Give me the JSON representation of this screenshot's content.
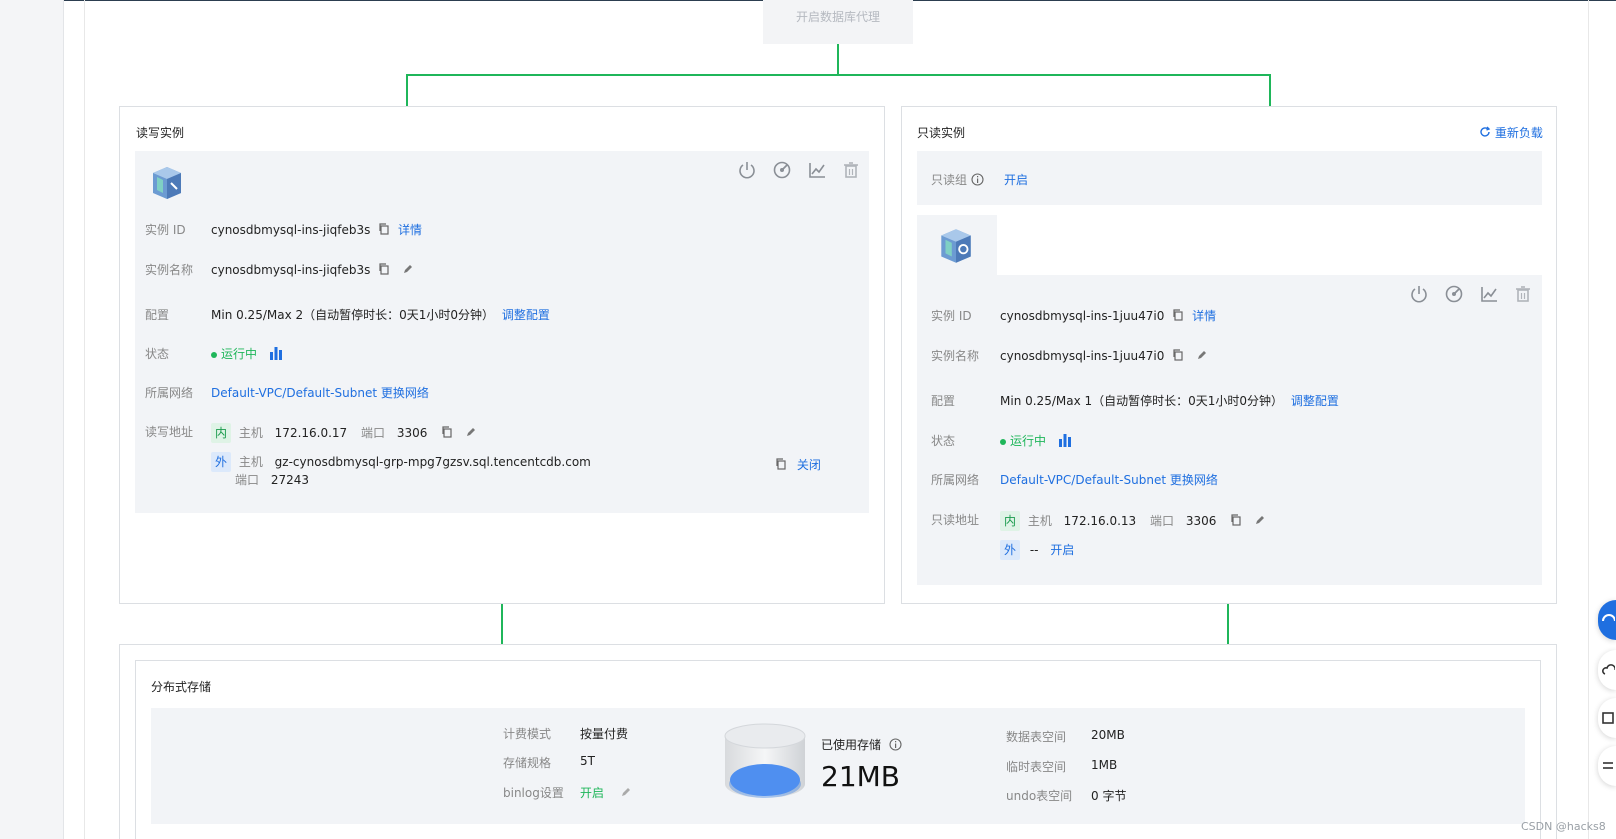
{
  "proxy": {
    "label": "开启数据库代理"
  },
  "rw": {
    "title": "读写实例",
    "id_label": "实例 ID",
    "id_value": "cynosdbmysql-ins-jiqfeb3s",
    "detail_link": "详情",
    "name_label": "实例名称",
    "name_value": "cynosdbmysql-ins-jiqfeb3s",
    "config_label": "配置",
    "config_value": "Min 0.25/Max 2（自动暂停时长：0天1小时0分钟）",
    "config_link": "调整配置",
    "status_label": "状态",
    "status_value": "运行中",
    "network_label": "所属网络",
    "vpc": "Default-VPC",
    "subnet": "/Default-Subnet",
    "change_net": "更换网络",
    "addr_label": "读写地址",
    "inner_tag": "内",
    "host_label": "主机",
    "inner_host": "172.16.0.17",
    "port_label": "端口",
    "inner_port": "3306",
    "outer_tag": "外",
    "outer_host": "gz-cynosdbmysql-grp-mpg7gzsv.sql.tencentcdb.com",
    "outer_port": "27243",
    "close_link": "关闭"
  },
  "ro": {
    "title": "只读实例",
    "reload_link": "重新负载",
    "group_label": "只读组",
    "group_link": "开启",
    "id_label": "实例 ID",
    "id_value": "cynosdbmysql-ins-1juu47i0",
    "detail_link": "详情",
    "name_label": "实例名称",
    "name_value": "cynosdbmysql-ins-1juu47i0",
    "config_label": "配置",
    "config_value": "Min 0.25/Max 1（自动暂停时长：0天1小时0分钟）",
    "config_link": "调整配置",
    "status_label": "状态",
    "status_value": "运行中",
    "network_label": "所属网络",
    "vpc": "Default-VPC",
    "subnet": "/Default-Subnet",
    "change_net": "更换网络",
    "addr_label": "只读地址",
    "inner_tag": "内",
    "host_label": "主机",
    "inner_host": "172.16.0.13",
    "port_label": "端口",
    "inner_port": "3306",
    "outer_tag": "外",
    "outer_value": "--",
    "outer_link": "开启"
  },
  "storage": {
    "title": "分布式存储",
    "billing_label": "计费模式",
    "billing_value": "按量付费",
    "spec_label": "存储规格",
    "spec_value": "5T",
    "binlog_label": "binlog设置",
    "binlog_value": "开启",
    "used_label": "已使用存储",
    "used_value": "21MB",
    "table_label": "数据表空间",
    "table_value": "20MB",
    "temp_label": "临时表空间",
    "temp_value": "1MB",
    "undo_label": "undo表空间",
    "undo_value": "0 字节"
  },
  "watermark": "CSDN @hacks8",
  "colors": {
    "accent": "#1f6fe0",
    "running": "#1fb65a",
    "line": "#1fb65a"
  }
}
